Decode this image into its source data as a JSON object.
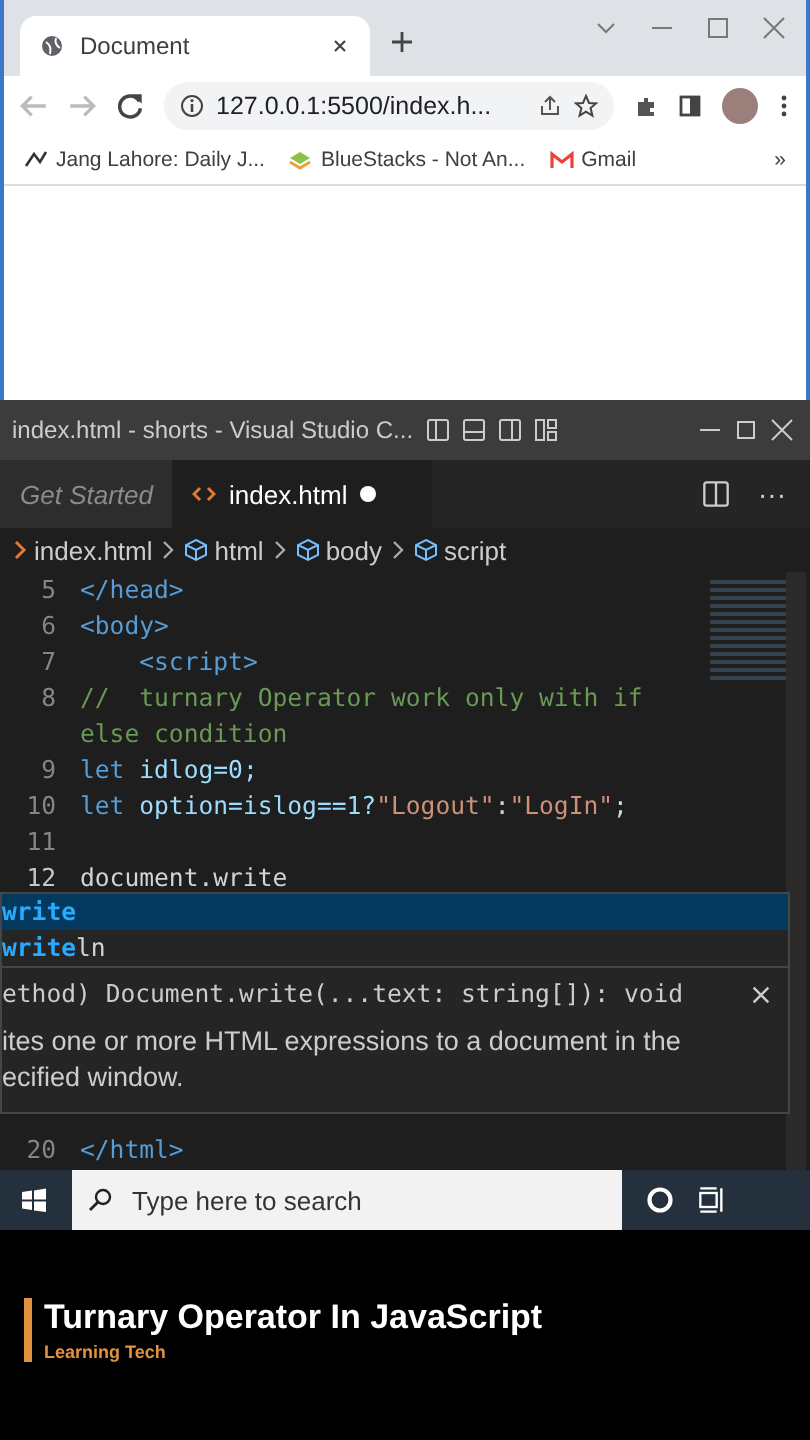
{
  "browser": {
    "tab": {
      "title": "Document"
    },
    "toolbar": {
      "back": {
        "disabled": true
      },
      "forward": {
        "disabled": true
      },
      "address": "127.0.0.1:5500/index.h..."
    },
    "bookmarks": [
      {
        "label": "Jang Lahore: Daily J...",
        "kind": "news"
      },
      {
        "label": "BlueStacks - Not An...",
        "kind": "app"
      },
      {
        "label": "Gmail",
        "kind": "mail"
      }
    ],
    "bookmarks_more": "»"
  },
  "editor": {
    "title": "index.html - shorts - Visual Studio C...",
    "tabs": [
      {
        "label": "Get Started",
        "selected": false,
        "modified": false
      },
      {
        "label": "index.html",
        "selected": true,
        "modified": true
      }
    ],
    "more": "···",
    "breadcrumb": [
      {
        "label": "index.html",
        "kind": "file"
      },
      {
        "label": "html",
        "kind": "element"
      },
      {
        "label": "body",
        "kind": "element"
      },
      {
        "label": "script",
        "kind": "element"
      }
    ],
    "lines": [
      {
        "number": "5",
        "tokens": [
          {
            "text": "</head>",
            "kind": "tag"
          }
        ]
      },
      {
        "number": "6",
        "tokens": [
          {
            "text": "<body>",
            "kind": "tag"
          }
        ]
      },
      {
        "number": "7",
        "tokens": [
          {
            "text": "    <script>",
            "kind": "tag"
          }
        ]
      },
      {
        "number": "8",
        "tokens": [
          {
            "text": "//  turnary Operator work only with if else condition",
            "kind": "comment"
          }
        ]
      },
      {
        "number": "9",
        "tokens": [
          {
            "text": "let",
            "kind": "keyword"
          },
          {
            "text": " idlog=0;",
            "kind": "variable"
          }
        ]
      },
      {
        "number": "10",
        "tokens": [
          {
            "text": "let",
            "kind": "keyword"
          },
          {
            "text": " option=islog==1?",
            "kind": "variable"
          },
          {
            "text": "\"Logout\"",
            "kind": "string"
          },
          {
            "text": ":",
            "kind": "plain"
          },
          {
            "text": "\"LogIn\"",
            "kind": "string"
          },
          {
            "text": ";",
            "kind": "plain"
          }
        ]
      },
      {
        "number": "11"
      },
      {
        "number": "12",
        "tokens": [
          {
            "text": "document.write",
            "kind": "plain"
          }
        ]
      }
    ],
    "suggestions": [
      {
        "match": "write",
        "selected": true
      },
      {
        "match": "write",
        "rest": "ln",
        "selected": false
      }
    ],
    "detail": {
      "signature": "ethod) Document.write(...text: string[]): void",
      "doc": [
        "ites one or more HTML expressions to a document in the",
        "ecified window."
      ]
    },
    "lines_below": [
      {
        "number": "20",
        "tokens": [
          {
            "text": "</html>",
            "kind": "tag"
          }
        ]
      }
    ]
  },
  "taskbar": {
    "search": {
      "placeholder": "Type here to search"
    }
  },
  "caption": {
    "title": "Turnary Operator In JavaScript",
    "channel": "Learning Tech"
  }
}
